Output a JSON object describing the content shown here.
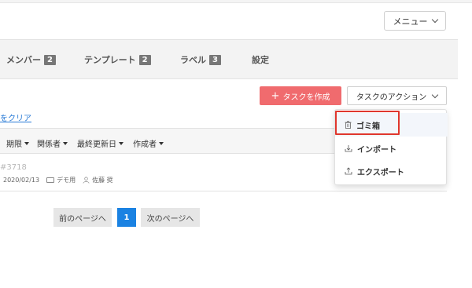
{
  "header": {
    "menu_label": "メニュー"
  },
  "tabs": [
    {
      "label": "メンバー",
      "count": "2"
    },
    {
      "label": "テンプレート",
      "count": "2"
    },
    {
      "label": "ラベル",
      "count": "3"
    },
    {
      "label": "設定"
    }
  ],
  "toolbar": {
    "create_label": "タスクを作成",
    "actions_label": "タスクのアクション"
  },
  "filter": {
    "clear_label": "をクリア"
  },
  "sort_columns": [
    "期限",
    "関係者",
    "最終更新日",
    "作成者"
  ],
  "task": {
    "id": "#3718",
    "date": "2020/02/13",
    "project": "デモ用",
    "assignee": "佐藤 奨"
  },
  "pagination": {
    "prev_label": "前のページへ",
    "current_page": "1",
    "next_label": "次のページへ"
  },
  "action_menu": {
    "items": [
      {
        "label": "ゴミ箱",
        "icon": "trash-icon"
      },
      {
        "label": "インポート",
        "icon": "import-icon"
      },
      {
        "label": "エクスポート",
        "icon": "export-icon"
      }
    ]
  },
  "colors": {
    "create_button": "#f06b6e",
    "current_page": "#1a82e2",
    "highlight_box": "#e0362d",
    "link": "#2a7bd6"
  }
}
